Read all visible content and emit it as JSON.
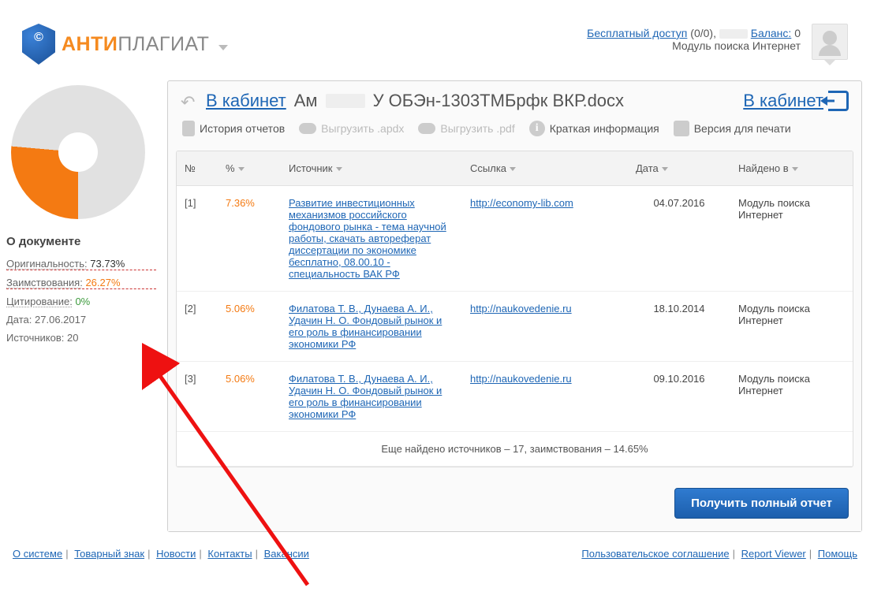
{
  "header": {
    "logo_orange": "АНТИ",
    "logo_gray": "ПЛАГИАТ",
    "free_access": "Бесплатный доступ",
    "free_access_count": "(0/0),",
    "balance_label": "Баланс:",
    "balance_value": "0",
    "module": "Модуль поиска Интернет"
  },
  "sidebar": {
    "about_doc": "О документе",
    "originality_label": "Оригинальность:",
    "originality_value": "73.73%",
    "borrow_label": "Заимствования:",
    "borrow_value": "26.27%",
    "citation_label": "Цитирование:",
    "citation_value": "0%",
    "date_label": "Дата:",
    "date_value": "27.06.2017",
    "sources_label": "Источников:",
    "sources_value": "20"
  },
  "panel": {
    "back_link": "В кабинет",
    "doc_prefix": "Ам",
    "doc_suffix": "У ОБЭн-1303ТМБрфк ВКР.docx",
    "right_link": "В кабинет"
  },
  "toolbar": {
    "history": "История отчетов",
    "export_apdx": "Выгрузить .apdx",
    "export_pdf": "Выгрузить .pdf",
    "brief": "Краткая информация",
    "print": "Версия для печати"
  },
  "table": {
    "col_num": "№",
    "col_pct": "%",
    "col_source": "Источник",
    "col_link": "Ссылка",
    "col_date": "Дата",
    "col_found": "Найдено в",
    "rows": [
      {
        "num": "[1]",
        "pct": "7.36%",
        "source": "Развитие инвестиционных механизмов российского фондового рынка - тема научной работы, скачать автореферат диссертации по экономике бесплатно, 08.00.10 - специальность ВАК РФ",
        "link": "http://economy-lib.com",
        "date": "04.07.2016",
        "module": "Модуль поиска Интернет"
      },
      {
        "num": "[2]",
        "pct": "5.06%",
        "source": "Филатова Т. В., Дунаева А. И., Удачин Н. О. Фондовый рынок и его роль в финансировании экономики РФ",
        "link": "http://naukovedenie.ru",
        "date": "18.10.2014",
        "module": "Модуль поиска Интернет"
      },
      {
        "num": "[3]",
        "pct": "5.06%",
        "source": "Филатова Т. В., Дунаева А. И., Удачин Н. О. Фондовый рынок и его роль в финансировании экономики РФ",
        "link": "http://naukovedenie.ru",
        "date": "09.10.2016",
        "module": "Модуль поиска Интернет"
      }
    ],
    "more": "Еще найдено источников – 17, заимствования – 14.65%"
  },
  "action": {
    "full_report": "Получить полный отчет"
  },
  "footer": {
    "left": [
      "О системе",
      "Товарный знак",
      "Новости",
      "Контакты",
      "Вакансии"
    ],
    "right": [
      "Пользовательское соглашение",
      "Report Viewer",
      "Помощь"
    ]
  },
  "chart_data": {
    "type": "pie",
    "title": "О документе",
    "series": [
      {
        "name": "Оригинальность",
        "value": 73.73,
        "color": "#e1e1e1"
      },
      {
        "name": "Заимствования",
        "value": 26.27,
        "color": "#f47a12"
      },
      {
        "name": "Цитирование",
        "value": 0,
        "color": "#3c9a3c"
      }
    ]
  }
}
